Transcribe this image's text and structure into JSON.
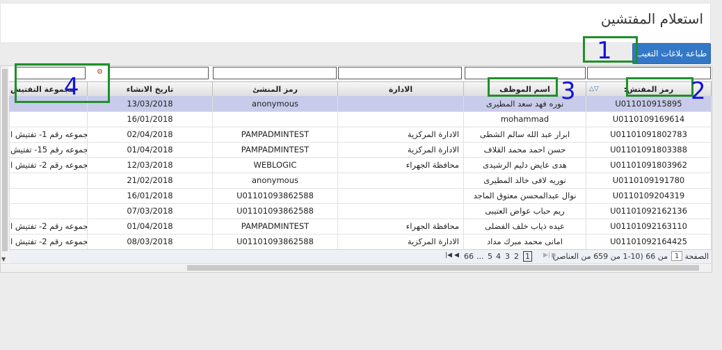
{
  "page": {
    "title": "استعلام المفتشين"
  },
  "toolbar": {
    "print_label": "طباعة بلاغات التغيب"
  },
  "grid": {
    "columns": [
      {
        "key": "code",
        "label": "رمز المفتش:"
      },
      {
        "key": "name",
        "label": "اسم الموظف"
      },
      {
        "key": "dept",
        "label": "الادارة"
      },
      {
        "key": "creator",
        "label": "رمز المنشئ"
      },
      {
        "key": "date",
        "label": "تاريخ الانشاء"
      },
      {
        "key": "group",
        "label": "مجموعة التفتيش"
      }
    ],
    "rows": [
      {
        "code": "U011010915895",
        "name": "نوره فهد سعد المطيرى",
        "dept": "",
        "creator": "anonymous",
        "date": "13/03/2018",
        "group": ""
      },
      {
        "code": "U0110109169614",
        "name": "mohammad",
        "dept": "",
        "creator": "",
        "date": "16/01/2018",
        "group": ""
      },
      {
        "code": "U01101091802783",
        "name": "ابرار عبد الله سالم الشطى",
        "dept": "الادارة المركزية",
        "creator": "PAMPADMINTEST",
        "date": "02/04/2018",
        "group": "مجموعه رقم 1- تفتيش ا"
      },
      {
        "code": "U01101091803388",
        "name": "حسن احمد محمد القلاف",
        "dept": "الادارة المركزية",
        "creator": "PAMPADMINTEST",
        "date": "01/04/2018",
        "group": "مجموعه رقم 15- تفتيش"
      },
      {
        "code": "U01101091803962",
        "name": "هدى عايض دليم الرشيدى",
        "dept": "محافظة الجهراء",
        "creator": "WEBLOGIC",
        "date": "12/03/2018",
        "group": "مجموعه رقم 2- تفتيش ا"
      },
      {
        "code": "U0110109191780",
        "name": "نوريه لافى خالد المطيرى",
        "dept": "",
        "creator": "anonymous",
        "date": "21/02/2018",
        "group": ""
      },
      {
        "code": "U0110109204319",
        "name": "نوال عبدالمحسن معتوق الماجد",
        "dept": "",
        "creator": "U01101093862588",
        "date": "16/01/2018",
        "group": ""
      },
      {
        "code": "U0110109216213‎6",
        "name": "ريم حباب عواض العتيبى",
        "dept": "",
        "creator": "U01101093862588",
        "date": "07/03/2018",
        "group": ""
      },
      {
        "code": "U01101092163110",
        "name": "عيده ذياب خلف الفضلى",
        "dept": "محافظة الجهراء",
        "creator": "PAMPADMINTEST",
        "date": "01/04/2018",
        "group": "مجموعه رقم 2- تفتيش ا"
      },
      {
        "code": "U01101092164425",
        "name": "امانى محمد مبرك مداد",
        "dept": "الادارة المركزية",
        "creator": "U01101093862588",
        "date": "08/03/2018",
        "group": "مجموعه رقم 2- تفتيش ا"
      }
    ]
  },
  "pager": {
    "page_label": "الصفحة",
    "current_page": "1",
    "summary": "من 66 (10-1 من 659 من العناصر)",
    "pages": [
      "1",
      "2",
      "3",
      "4",
      "5"
    ],
    "ellipsis": "...",
    "last_page": "66"
  },
  "annotations": [
    "1",
    "2",
    "3",
    "4"
  ],
  "colors": {
    "accent": "#3378c6",
    "annotation_box": "#1f8f2a",
    "annotation_number": "#1414d8",
    "selected_row": "#c8cbe9"
  }
}
